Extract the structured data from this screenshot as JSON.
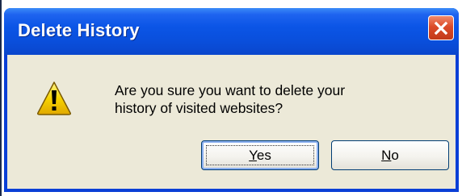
{
  "dialog": {
    "title": "Delete History",
    "message_line1": "Are you sure you want to delete your",
    "message_line2": "history of visited websites?",
    "icon": "warning-icon",
    "close_icon": "close-icon"
  },
  "buttons": {
    "yes": {
      "accel": "Y",
      "rest": "es"
    },
    "no": {
      "accel": "N",
      "rest": "o"
    }
  },
  "colors": {
    "titlebar": "#0b55e6",
    "body": "#ece9d8",
    "close": "#dc4b28",
    "warning_fill": "#f7d300"
  }
}
